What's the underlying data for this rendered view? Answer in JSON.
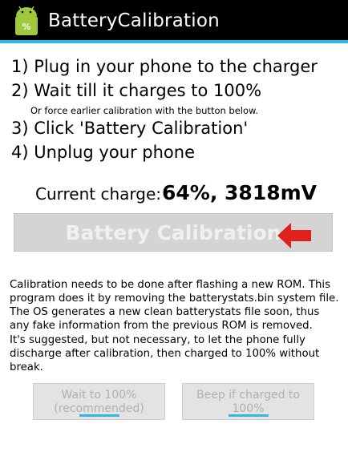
{
  "app": {
    "title": "BatteryCalibration",
    "icon": "android-battery-icon"
  },
  "steps": [
    "1) Plug in your phone to the charger",
    "2) Wait till it charges to 100%",
    "3) Click 'Battery Calibration'",
    "4) Unplug your phone"
  ],
  "steps_note": "Or force earlier calibration with the button below.",
  "charge": {
    "label": "Current charge:",
    "value": "64%, 3818mV"
  },
  "calibrate_button": {
    "label": "Battery Calibration",
    "enabled": false
  },
  "info": [
    "Calibration needs to be done after flashing a new ROM. This program does it by removing the batterystats.bin system file. The OS generates a new clean batterystats file soon, thus any fake information from the previous ROM is removed.",
    "It's suggested, but not necessary, to let the phone fully discharge after calibration, then charged to 100% without break."
  ],
  "toggles": [
    {
      "label": "Wait to 100%\n(recommended)",
      "state": "off",
      "enabled": false
    },
    {
      "label": "Beep if charged to\n100%",
      "state": "off",
      "enabled": false
    }
  ],
  "colors": {
    "accent": "#33b5e5",
    "arrow": "#e0201b",
    "actionbar": "#000000"
  }
}
